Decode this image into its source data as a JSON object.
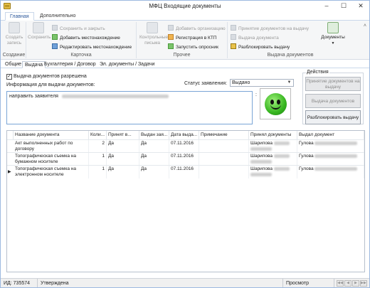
{
  "window": {
    "title": "МФЦ Входящие документы"
  },
  "ribbon_tabs": [
    "Главная",
    "Дополнительно"
  ],
  "ribbon": {
    "groups": {
      "create": {
        "label": "Создание",
        "create_record": "Создать запись"
      },
      "card": {
        "label": "Карточка",
        "save": "Сохранить",
        "save_close": "Сохранить и закрыть",
        "add_location": "Добавить местонахождение",
        "edit_location": "Редактировать местонахождение"
      },
      "other": {
        "label": "Прочее",
        "control_letters": "Контрольные письма",
        "add_org": "Добавить организацию",
        "register_ktp": "Регистрация в КТП",
        "start_survey": "Запустить опросник"
      },
      "issue": {
        "label": "Выдача документов",
        "accept_docs": "Принятие документов на выдачу",
        "issue_doc": "Выдача документа",
        "unlock_issue": "Разблокировать выдачу",
        "documents": "Документы"
      }
    }
  },
  "tabs": [
    "Общие",
    "Выдача",
    "Бухгалтерия / Договор",
    "Эл. документы / Задачи"
  ],
  "form": {
    "issue_allowed_label": "Выдача документов разрешена",
    "issue_allowed_checked": true,
    "info_label": "Информация для выдачи документов:",
    "info_text": "направить заявителя",
    "status_label": "Статус заявления:",
    "status_value": "Выдано"
  },
  "actions": {
    "legend": "Действия",
    "accept_docs": "Принятие документов на выдачу",
    "issue_docs": "Выдача документов",
    "unlock_issue": "Разблокировать выдачу"
  },
  "table": {
    "columns": [
      "Название документа",
      "Коли...",
      "Принят в...",
      "Выдан зая...",
      "Дата выда...",
      "Примечание",
      "Принял документы",
      "Выдал документ"
    ],
    "rows": [
      {
        "name": "Акт выполненных работ по договору",
        "qty": "2",
        "accepted": "Да",
        "issued": "Да",
        "date": "07.11.2016",
        "note": "",
        "accepted_by": "Шарипова",
        "issued_by": "Гулова"
      },
      {
        "name": "Топографическая съемка на бумажном носителе",
        "qty": "1",
        "accepted": "Да",
        "issued": "Да",
        "date": "07.11.2016",
        "note": "",
        "accepted_by": "Шарипова",
        "issued_by": "Гулова"
      },
      {
        "name": "Топографическая съемка на электронном носителе",
        "qty": "1",
        "accepted": "Да",
        "issued": "Да",
        "date": "07.11.2016",
        "note": "",
        "accepted_by": "Шарипова",
        "issued_by": "Гулова"
      }
    ]
  },
  "statusbar": {
    "id": "ИД: 735574",
    "state": "Утверждена",
    "mode": "Просмотр"
  }
}
